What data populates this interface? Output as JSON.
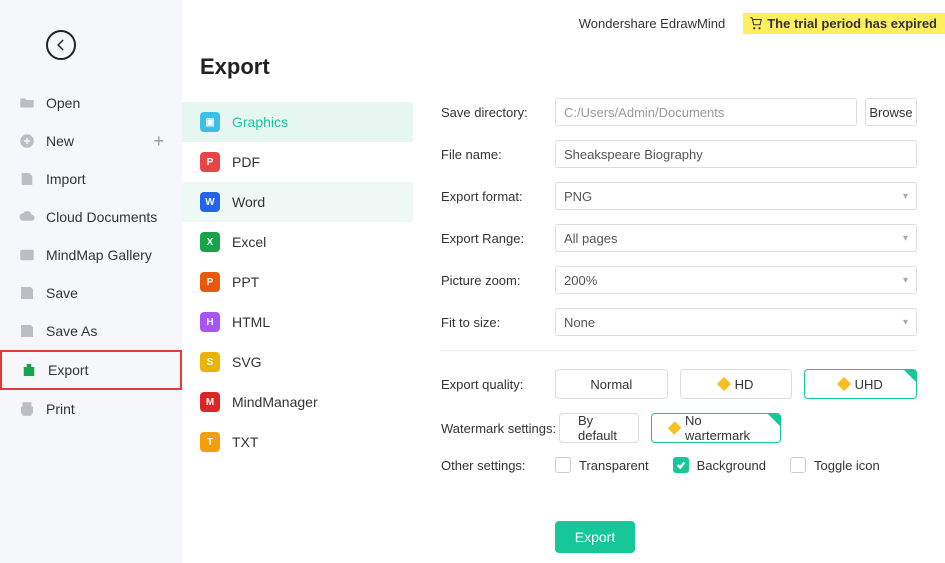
{
  "brand": "Wondershare EdrawMind",
  "trialBanner": "The trial period has expired",
  "leftNav": {
    "items": [
      {
        "id": "open",
        "label": "Open"
      },
      {
        "id": "new",
        "label": "New"
      },
      {
        "id": "import",
        "label": "Import"
      },
      {
        "id": "cloud",
        "label": "Cloud Documents"
      },
      {
        "id": "gallery",
        "label": "MindMap Gallery"
      },
      {
        "id": "save",
        "label": "Save"
      },
      {
        "id": "saveas",
        "label": "Save As"
      },
      {
        "id": "export",
        "label": "Export"
      },
      {
        "id": "print",
        "label": "Print"
      }
    ]
  },
  "middle": {
    "title": "Export",
    "formats": [
      {
        "id": "graphics",
        "label": "Graphics"
      },
      {
        "id": "pdf",
        "label": "PDF"
      },
      {
        "id": "word",
        "label": "Word"
      },
      {
        "id": "excel",
        "label": "Excel"
      },
      {
        "id": "ppt",
        "label": "PPT"
      },
      {
        "id": "html",
        "label": "HTML"
      },
      {
        "id": "svg",
        "label": "SVG"
      },
      {
        "id": "mindmanager",
        "label": "MindManager"
      },
      {
        "id": "txt",
        "label": "TXT"
      }
    ]
  },
  "settings": {
    "labels": {
      "saveDir": "Save directory:",
      "fileName": "File name:",
      "exportFormat": "Export format:",
      "exportRange": "Export Range:",
      "pictureZoom": "Picture zoom:",
      "fitToSize": "Fit to size:",
      "exportQuality": "Export quality:",
      "watermark": "Watermark settings:",
      "other": "Other settings:"
    },
    "values": {
      "saveDir": "C:/Users/Admin/Documents",
      "fileName": "Sheakspeare Biography",
      "exportFormat": "PNG",
      "exportRange": "All pages",
      "pictureZoom": "200%",
      "fitToSize": "None"
    },
    "browse": "Browse",
    "quality": {
      "normal": "Normal",
      "hd": "HD",
      "uhd": "UHD"
    },
    "watermarkOpts": {
      "default": "By default",
      "none": "No wartermark"
    },
    "checkboxes": {
      "transparent": "Transparent",
      "background": "Background",
      "toggleIcon": "Toggle icon"
    },
    "exportBtn": "Export"
  }
}
